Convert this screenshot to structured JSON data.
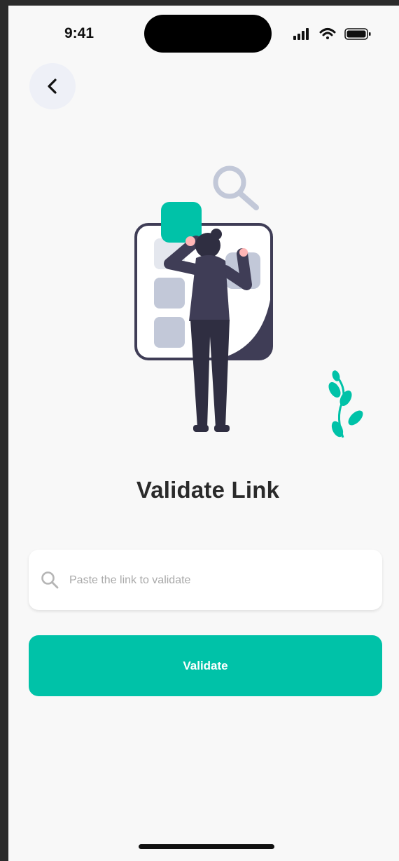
{
  "status_bar": {
    "time": "9:41",
    "icons": [
      "signal-icon",
      "wifi-icon",
      "battery-icon"
    ]
  },
  "header": {
    "back_icon": "chevron-left-icon"
  },
  "main": {
    "title": "Validate Link",
    "search": {
      "placeholder": "Paste the link to validate",
      "value": "",
      "icon": "search-icon"
    },
    "validate_label": "Validate"
  },
  "colors": {
    "accent": "#00c2a8",
    "background": "#f8f8f8",
    "figure_dark": "#3f3d56",
    "tile": "#c2c8d8"
  }
}
